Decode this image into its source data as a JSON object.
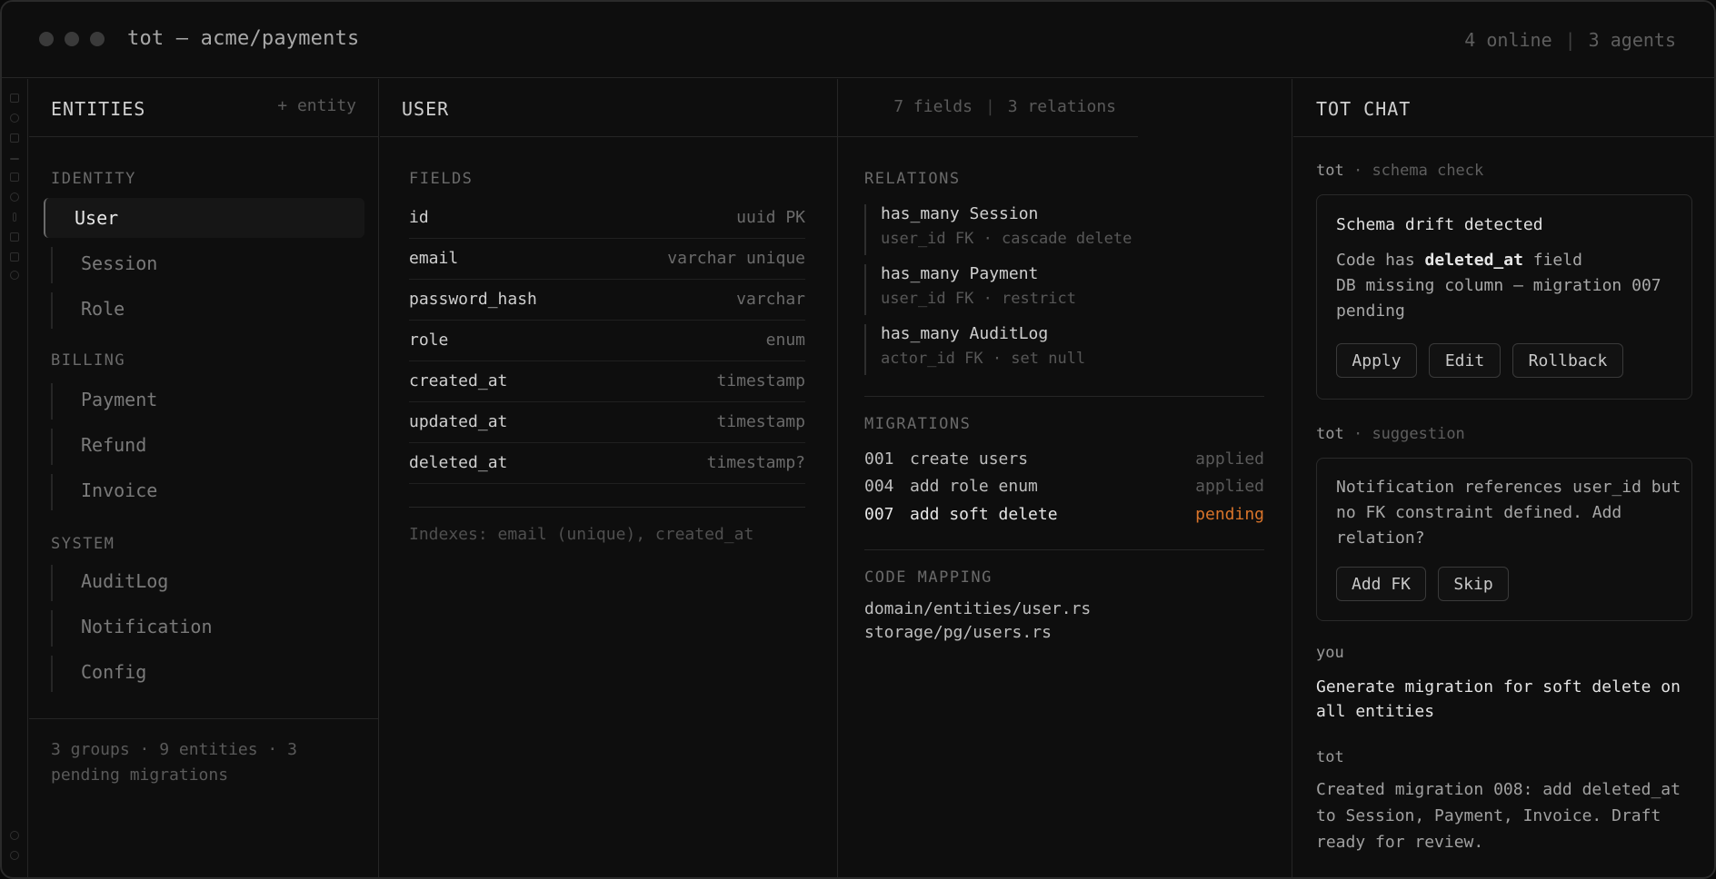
{
  "window": {
    "title": "tot — acme/payments",
    "online": "4 online",
    "separator": "|",
    "agents": "3 agents"
  },
  "entities": {
    "header": "ENTITIES",
    "add_label": "+ entity",
    "groups": [
      {
        "label": "IDENTITY",
        "items": [
          "User",
          "Session",
          "Role"
        ]
      },
      {
        "label": "BILLING",
        "items": [
          "Payment",
          "Refund",
          "Invoice"
        ]
      },
      {
        "label": "SYSTEM",
        "items": [
          "AuditLog",
          "Notification",
          "Config"
        ]
      }
    ],
    "selected": "User",
    "footer": "3 groups · 9 entities · 3 pending migrations"
  },
  "detail": {
    "header": "USER",
    "fields_count": "7 fields",
    "separator": "|",
    "relations_count": "3 relations",
    "fields_label": "FIELDS",
    "fields": [
      {
        "name": "id",
        "type": "uuid PK"
      },
      {
        "name": "email",
        "type": "varchar unique"
      },
      {
        "name": "password_hash",
        "type": "varchar"
      },
      {
        "name": "role",
        "type": "enum"
      },
      {
        "name": "created_at",
        "type": "timestamp"
      },
      {
        "name": "updated_at",
        "type": "timestamp"
      },
      {
        "name": "deleted_at",
        "type": "timestamp?"
      }
    ],
    "indexes": "Indexes: email (unique), created_at"
  },
  "relations": {
    "label": "RELATIONS",
    "items": [
      {
        "title": "has_many Session",
        "detail": "user_id FK · cascade delete"
      },
      {
        "title": "has_many Payment",
        "detail": "user_id FK · restrict"
      },
      {
        "title": "has_many AuditLog",
        "detail": "actor_id FK · set null"
      }
    ],
    "migrations_label": "MIGRATIONS",
    "migrations": [
      {
        "num": "001",
        "name": "create users",
        "status": "applied"
      },
      {
        "num": "004",
        "name": "add role enum",
        "status": "applied"
      },
      {
        "num": "007",
        "name": "add soft delete",
        "status": "pending"
      }
    ],
    "mapping_label": "CODE MAPPING",
    "mapping": [
      "domain/entities/user.rs",
      "storage/pg/users.rs"
    ]
  },
  "chat": {
    "header": "TOT CHAT",
    "msg1_speaker": "tot",
    "msg1_kind": "· schema check",
    "card1_title": "Schema drift detected",
    "card1_line1_pre": "Code has ",
    "card1_line1_bold": "deleted_at",
    "card1_line1_post": " field",
    "card1_line2": "DB missing column — migration 007 pending",
    "card1_buttons": [
      "Apply",
      "Edit",
      "Rollback"
    ],
    "msg2_speaker": "tot",
    "msg2_kind": "· suggestion",
    "card2_text": "Notification references user_id but no FK constraint defined. Add relation?",
    "card2_buttons": [
      "Add FK",
      "Skip"
    ],
    "you_speaker": "you",
    "you_text": "Generate migration for soft delete on all entities",
    "tot_speaker": "tot",
    "tot_text": "Created migration 008: add deleted_at to Session, Payment, Invoice. Draft ready for review.",
    "accent_pending": "#d9742a"
  }
}
